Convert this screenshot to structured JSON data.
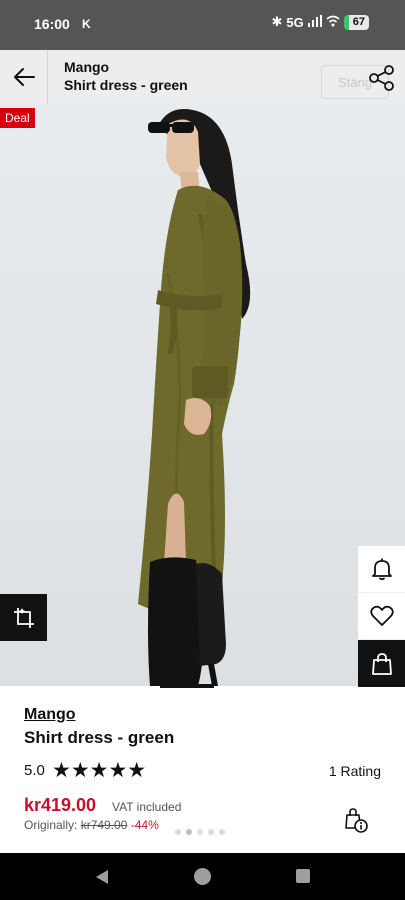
{
  "status_bar": {
    "time": "16:00",
    "carrier_glyph": "K",
    "network": "5G",
    "battery": "67"
  },
  "header": {
    "brand": "Mango",
    "title": "Shirt dress - green",
    "close_label": "Stäng"
  },
  "image": {
    "badge": "Deal"
  },
  "product": {
    "brand": "Mango",
    "name": "Shirt dress - green",
    "rating_value": "5.0",
    "rating": 5,
    "stars": "★★★★★",
    "rating_count": "1 Rating",
    "price": "kr419.00",
    "vat_note": "VAT included",
    "original_label": "Originally:",
    "original_price": "kr749.00",
    "discount": "-44%",
    "image_count": 5,
    "active_image": 2
  },
  "colors": {
    "accent_red": "#c8102e",
    "deal_red": "#d6000f",
    "dress_green": "#6e6a2c"
  },
  "icons": {
    "back": "arrow-left-icon",
    "share": "share-icon",
    "bell": "bell-icon",
    "heart": "heart-icon",
    "bag": "shopping-bag-icon",
    "crop": "crop-search-icon",
    "info": "size-info-icon"
  }
}
